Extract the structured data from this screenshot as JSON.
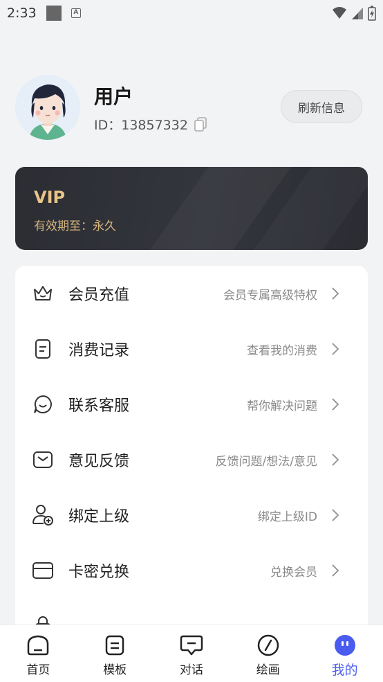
{
  "status_bar": {
    "time": "2:33"
  },
  "profile": {
    "name": "用户",
    "id_text": "ID：13857332",
    "refresh_label": "刷新信息"
  },
  "vip": {
    "title": "VIP",
    "validity": "有效期至：永久"
  },
  "menu": {
    "items": [
      {
        "icon": "crown-icon",
        "label": "会员充值",
        "desc": "会员专属高级特权"
      },
      {
        "icon": "receipt-icon",
        "label": "消费记录",
        "desc": "查看我的消费"
      },
      {
        "icon": "smile-chat-icon",
        "label": "联系客服",
        "desc": "帮你解决问题"
      },
      {
        "icon": "mail-icon",
        "label": "意见反馈",
        "desc": "反馈问题/想法/意见"
      },
      {
        "icon": "user-add-icon",
        "label": "绑定上级",
        "desc": "绑定上级ID"
      },
      {
        "icon": "card-icon",
        "label": "卡密兑换",
        "desc": "兑换会员"
      }
    ]
  },
  "bottom_nav": {
    "items": [
      {
        "icon": "home-icon",
        "label": "首页"
      },
      {
        "icon": "template-icon",
        "label": "模板"
      },
      {
        "icon": "chat-icon",
        "label": "对话"
      },
      {
        "icon": "paint-icon",
        "label": "绘画"
      },
      {
        "icon": "profile-icon",
        "label": "我的"
      }
    ],
    "active_index": 4
  },
  "colors": {
    "accent": "#4a5cf0",
    "vip_gold": "#e9c487",
    "vip_bg": "#2b2d33"
  }
}
